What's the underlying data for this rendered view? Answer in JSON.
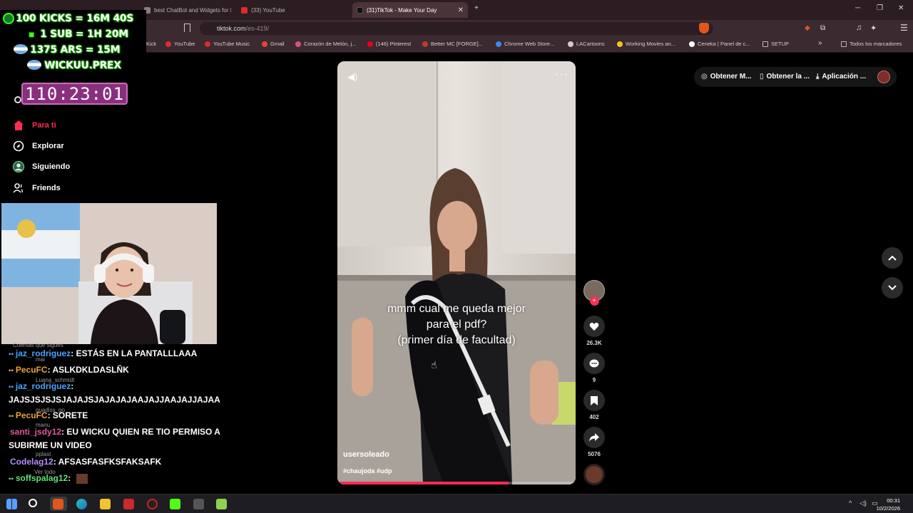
{
  "browser": {
    "tabs": [
      {
        "label": "best ChatBot and Widgets for Ki",
        "color": "#8a7c80"
      },
      {
        "label": "(33) YouTube",
        "color": "#e02b2b"
      },
      {
        "label": "(31)TikTok - Make Your Day",
        "color": "#111111"
      }
    ],
    "url_host": "tiktok.com",
    "url_path": "/es-419/",
    "bookmarks": [
      {
        "label": "Kick",
        "color": "#53fc18"
      },
      {
        "label": "YouTube",
        "color": "#e02b2b"
      },
      {
        "label": "YouTube Music",
        "color": "#e02b2b"
      },
      {
        "label": "Gmail",
        "color": "#ea4335"
      },
      {
        "label": "Corazón de Melón, j...",
        "color": "#d94f8a"
      },
      {
        "label": "(146) Pinterest",
        "color": "#e60023"
      },
      {
        "label": "Better MC [FORGE]...",
        "color": "#c0392b"
      },
      {
        "label": "Chrome Web Store...",
        "color": "#4285f4"
      },
      {
        "label": "LACartoons",
        "color": "#cccccc"
      },
      {
        "label": "Working Movies an...",
        "color": "#f5c518"
      },
      {
        "label": "Ceneka | Panel de c...",
        "color": "#ffffff"
      },
      {
        "label": "SETUP",
        "color": "#bbbbbb"
      },
      {
        "label": "Todos los marcadores",
        "color": "#bbbbbb"
      }
    ]
  },
  "stream_overlay": {
    "line1": "100 KICKS = 16M 40S",
    "line2": "1 SUB = 1H 20M",
    "line3": "1375 ARS = 15M",
    "line4": "WICKUU.PREX",
    "timer": "110:23:01"
  },
  "sidebar": {
    "items": [
      {
        "label": "Para ti",
        "active": true
      },
      {
        "label": "Explorar",
        "active": false
      },
      {
        "label": "Siguiendo",
        "active": false
      },
      {
        "label": "Friends",
        "active": false
      }
    ]
  },
  "chat": {
    "messages": [
      {
        "user": "jaz_rodriguez",
        "text": ": ESTÁS EN LA PANTALLLAAA",
        "color": "#4aa3ff"
      },
      {
        "user": "PecuFC",
        "text": ": ASLKDKLDASLÑK",
        "color": "#e8a53a"
      },
      {
        "user": "jaz_rodriguez",
        "text": ":",
        "color": "#4aa3ff"
      },
      {
        "user": "",
        "text": "JAJSJSJSJSJAJAJSJAJAJAJAAJAJJAAJAJJAJAA",
        "color": "#ffffff"
      },
      {
        "user": "PecuFC",
        "text": ": SORETE",
        "color": "#e8a53a"
      },
      {
        "user": "santi_jsdy12",
        "text": ": EU WICKU QUIEN RE TIO PERMISO A",
        "color": "#e05a9a"
      },
      {
        "user": "",
        "text": "SUBIRME UN VIDEO",
        "color": "#ffffff"
      },
      {
        "user": "Codelag12",
        "text": ": AFSASFASFKSFAKSAFK",
        "color": "#b48cff"
      },
      {
        "user": "soffspalag12",
        "text": ":",
        "color": "#5fe07a"
      }
    ],
    "ghost": [
      "Cuentas que sigues",
      "mai",
      "Luana_schmidt",
      "guadiss_go",
      "manu",
      "pplast",
      "Ver todo"
    ]
  },
  "video": {
    "caption_line1": "mmm cual me queda mejor",
    "caption_line2": "para el pdf?",
    "caption_line3": "(primer día de facultad)",
    "username": "usersoleado",
    "hashtags": "#chaujoda #udp",
    "progress": 0.72,
    "likes": "26.3K",
    "comments": "9",
    "saves": "402",
    "shares": "5076"
  },
  "topbar": {
    "item1": "Obtener M...",
    "item2": "Obtener la ...",
    "item3": "Aplicación ..."
  },
  "taskbar": {
    "time": "00:31",
    "date": "10/2/2026"
  }
}
